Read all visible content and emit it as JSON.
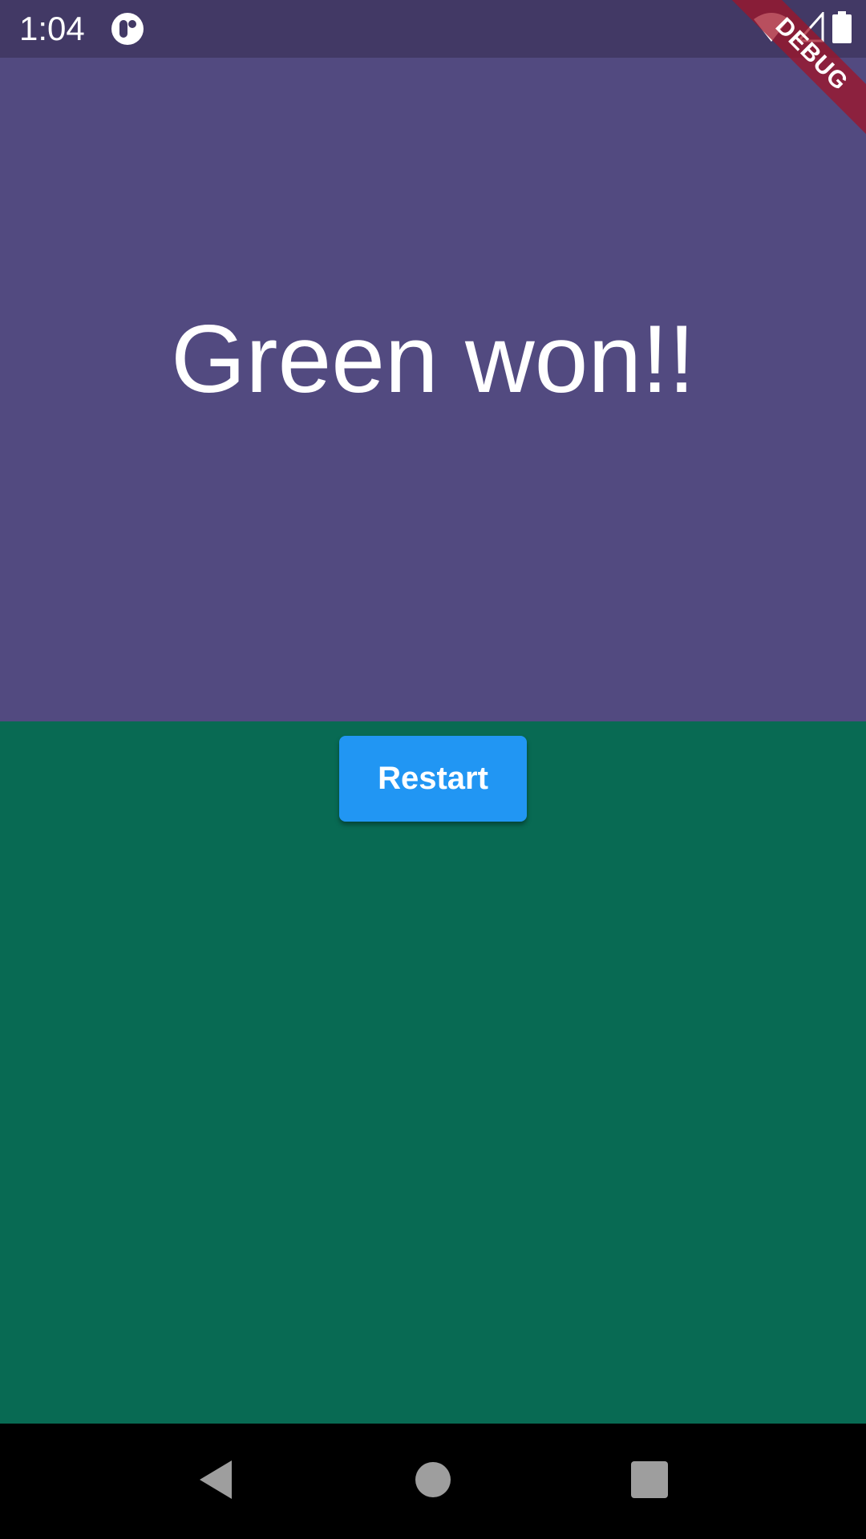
{
  "status_bar": {
    "time": "1:04",
    "icons": [
      "app-notification-icon",
      "wifi-icon",
      "cell-signal-icon",
      "battery-icon"
    ],
    "background": "#423965"
  },
  "game": {
    "result_text": "Green won!!",
    "restart_label": "Restart",
    "top_color": "#524a80",
    "bottom_color": "#086a53",
    "button_color": "#2196f3"
  },
  "debug_banner": {
    "label": "DEBUG"
  },
  "nav_bar": {
    "buttons": [
      "back-icon",
      "home-icon",
      "recents-icon"
    ]
  }
}
